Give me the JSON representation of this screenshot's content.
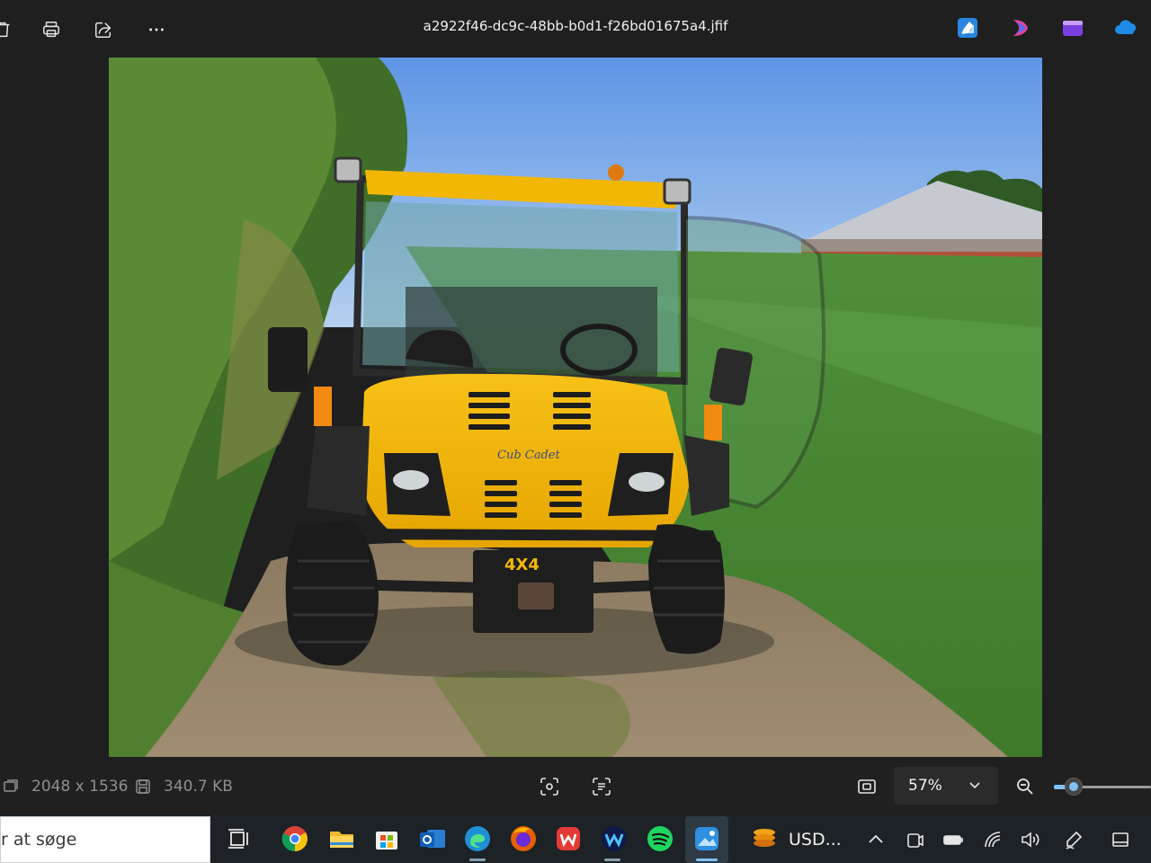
{
  "toolbar": {
    "filename": "a2922f46-dc9c-48bb-b0d1-f26bd01675a4.jfif",
    "icons": [
      "delete-icon",
      "print-icon",
      "share-icon",
      "more-icon"
    ],
    "app_icons": [
      "photos-editor-icon",
      "copilot-icon",
      "clipchamp-icon",
      "onedrive-icon"
    ]
  },
  "photo": {
    "brand_text": "Cub Cadet",
    "badge_text": "4X4"
  },
  "statusbar": {
    "dimensions": "2048 x 1536",
    "filesize": "340.7 KB",
    "zoom": "57%",
    "zoom_level": 0.2
  },
  "taskbar": {
    "search_text": "r at søge",
    "usd_label": "USD...",
    "apps": [
      "task-view",
      "chrome",
      "file-explorer",
      "microsoft-store",
      "outlook",
      "edge",
      "firefox",
      "wps-office",
      "webex",
      "spotify",
      "photos"
    ],
    "tray": [
      "chevron-up",
      "meet-now",
      "battery",
      "wifi",
      "volume",
      "pen",
      "tablet"
    ]
  },
  "colors": {
    "accent": "#7fc1f5",
    "vehicle_yellow": "#f2b705",
    "background": "#1f1f1f"
  }
}
